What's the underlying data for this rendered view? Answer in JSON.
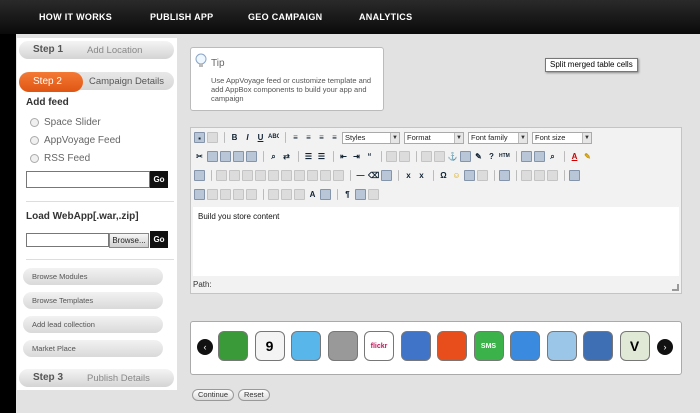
{
  "nav": {
    "items": [
      "HOW IT WORKS",
      "PUBLISH APP",
      "GEO CAMPAIGN",
      "ANALYTICS"
    ]
  },
  "steps": [
    {
      "number": "Step 1",
      "label": "Add Location"
    },
    {
      "number": "Step 2",
      "label": "Campaign Details"
    },
    {
      "number": "Step 3",
      "label": "Publish Details"
    }
  ],
  "add_feed": {
    "title": "Add feed",
    "options": [
      "Space Slider",
      "AppVoyage Feed",
      "RSS Feed"
    ],
    "go_label": "Go"
  },
  "load_webapp": {
    "title": "Load WebApp[.war,.zip]",
    "browse_label": "Browse...",
    "go_label": "Go"
  },
  "side_links": [
    "Browse Modules",
    "Browse Templates",
    "Add lead collection",
    "Market Place"
  ],
  "tip": {
    "title": "Tip",
    "body": "Use AppVoyage feed or customize template and add AppBox components to build your app and campaign"
  },
  "tooltip": "Split merged table cells",
  "editor": {
    "dropdowns": [
      "Styles",
      "Format",
      "Font family",
      "Font size"
    ],
    "content": "Build you store content",
    "path_label": "Path:"
  },
  "carousel": {
    "apps": [
      {
        "name": "phone-app-icon",
        "color": "#3a9a3a",
        "text": ""
      },
      {
        "name": "calendar-app-icon",
        "color": "#f4f4f4",
        "text": "9"
      },
      {
        "name": "twitter-app-icon",
        "color": "#59b6ea",
        "text": ""
      },
      {
        "name": "stack-app-icon",
        "color": "#999999",
        "text": ""
      },
      {
        "name": "flickr-app-icon",
        "color": "#ffffff",
        "text": "flickr"
      },
      {
        "name": "check-app-icon",
        "color": "#3f74c9",
        "text": ""
      },
      {
        "name": "rss-app-icon",
        "color": "#e84e1b",
        "text": ""
      },
      {
        "name": "sms-app-icon",
        "color": "#3bb34a",
        "text": "SMS"
      },
      {
        "name": "mail-app-icon",
        "color": "#3a8be0",
        "text": ""
      },
      {
        "name": "maps-app-icon",
        "color": "#9cc6e8",
        "text": ""
      },
      {
        "name": "tools-app-icon",
        "color": "#3e6fb4",
        "text": ""
      },
      {
        "name": "vine-app-icon",
        "color": "#1f7a2f",
        "text": "V"
      }
    ]
  },
  "buttons": {
    "continue": "Continue",
    "reset": "Reset"
  }
}
